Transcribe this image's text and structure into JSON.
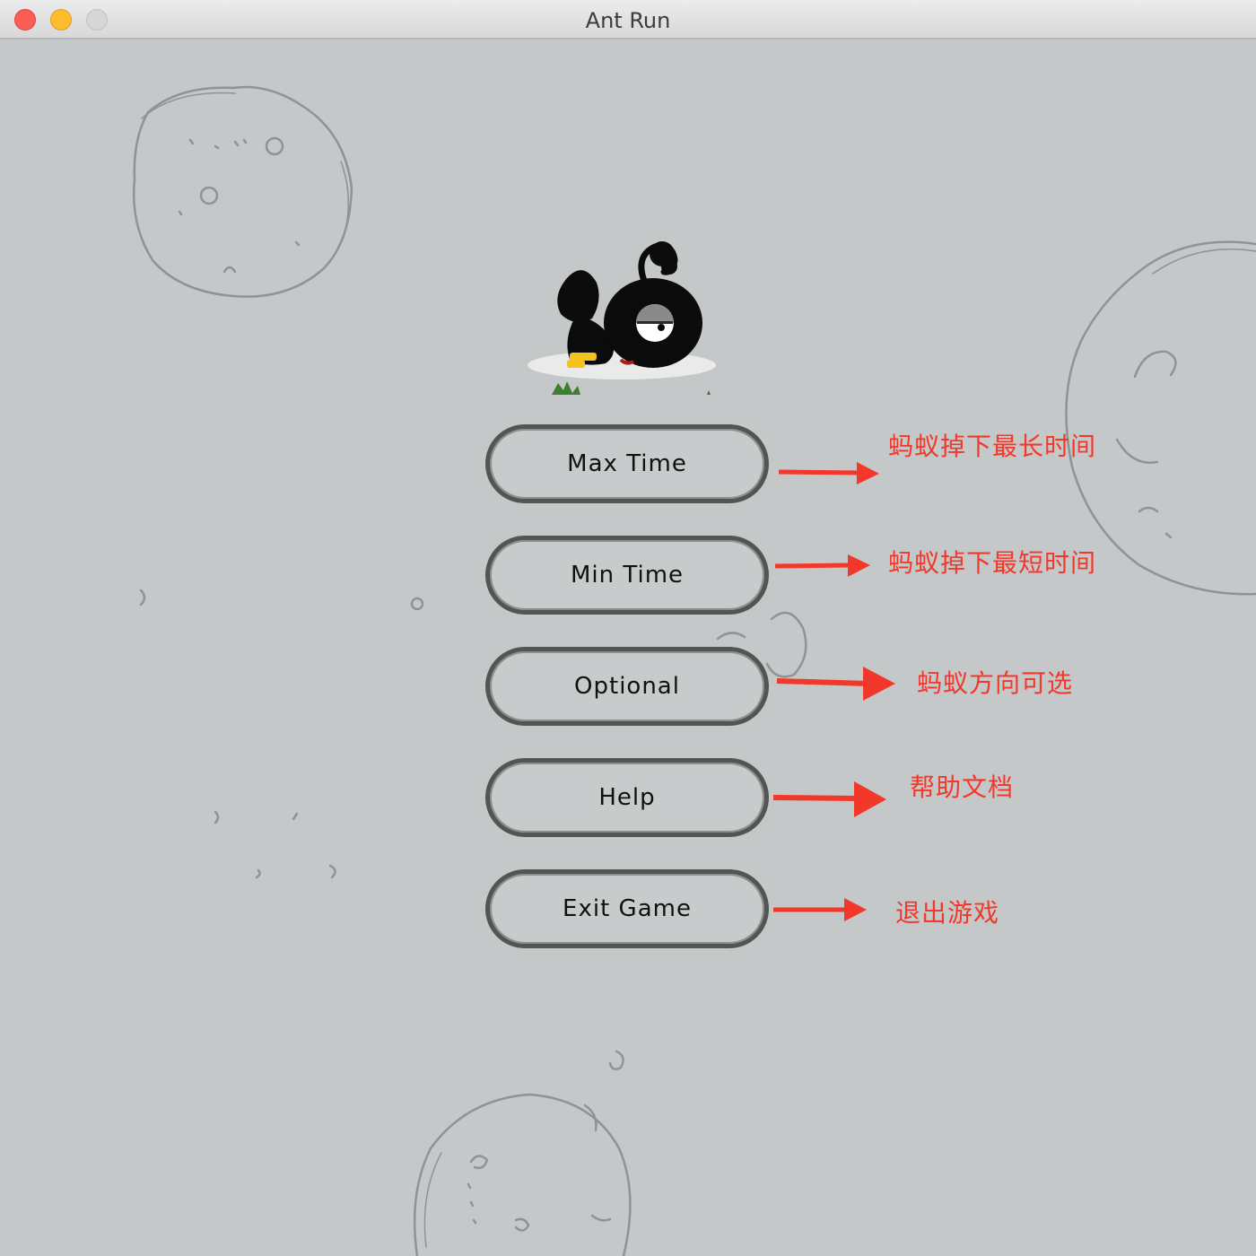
{
  "window": {
    "title": "Ant Run"
  },
  "colors": {
    "background": "#c4c8c8",
    "button_border": "#545454",
    "annotation": "#f2372b"
  },
  "menu": {
    "buttons": [
      {
        "label": "Max Time",
        "icon": ""
      },
      {
        "label": "Min Time",
        "icon": ""
      },
      {
        "label": "Optional",
        "icon": ""
      },
      {
        "label": "Help",
        "icon": ""
      },
      {
        "label": "Exit Game",
        "icon": ""
      }
    ]
  },
  "annotations": [
    {
      "text": "蚂蚁掉下最长时间",
      "target": "Max Time"
    },
    {
      "text": "蚂蚁掉下最短时间",
      "target": "Min Time"
    },
    {
      "text": "蚂蚁方向可选",
      "target": "Optional"
    },
    {
      "text": "帮助文档",
      "target": "Help"
    },
    {
      "text": "退出游戏",
      "target": "Exit Game"
    }
  ],
  "icons": {
    "logo": "ant-mascot-icon",
    "close": "close-window-icon",
    "minimize": "minimize-window-icon",
    "zoom": "zoom-window-icon"
  }
}
